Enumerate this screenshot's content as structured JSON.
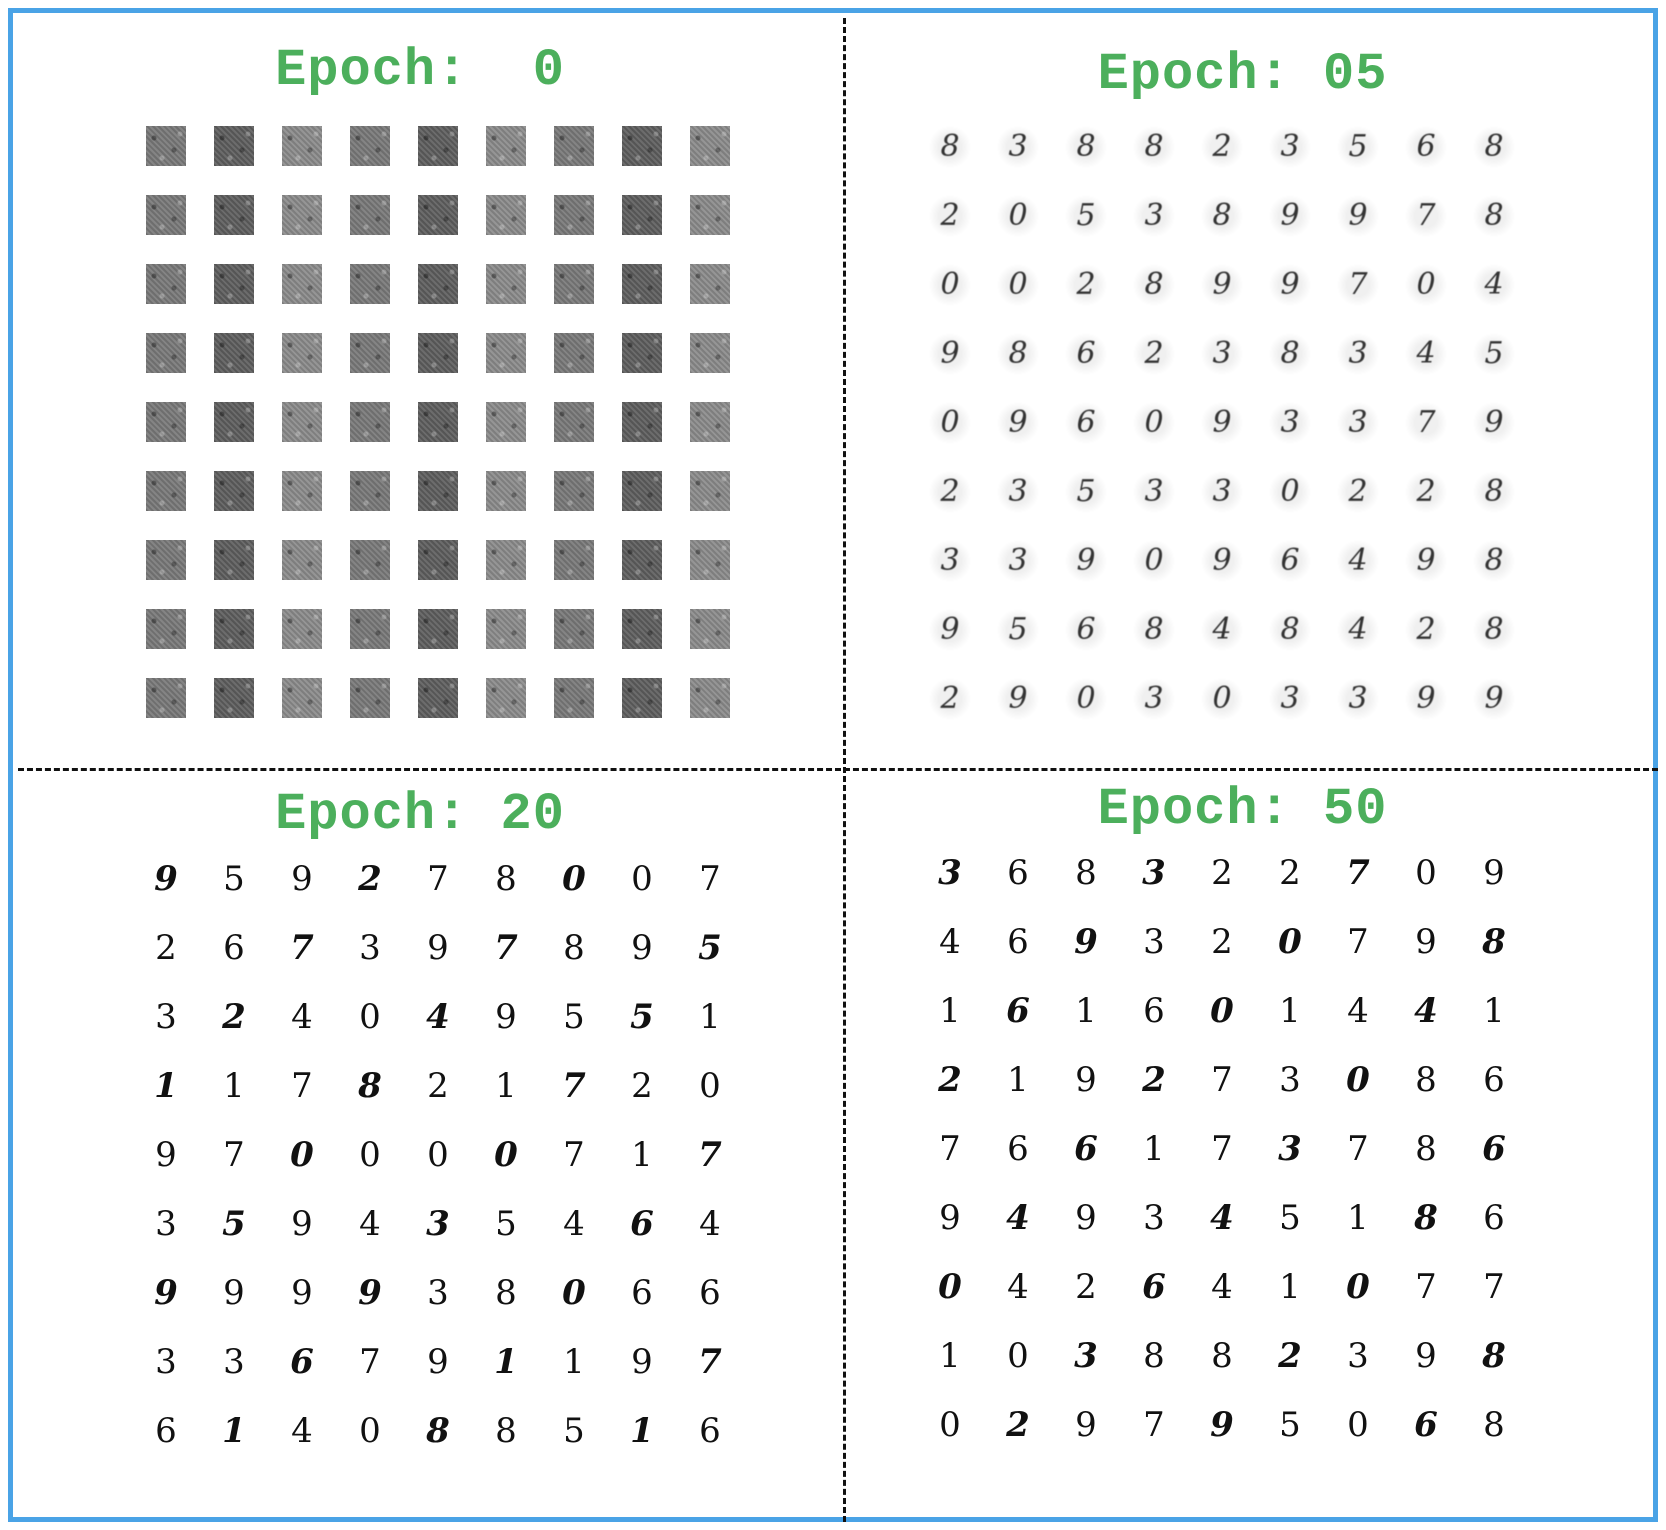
{
  "colors": {
    "frame": "#4aa3e6",
    "title": "#4caf5c",
    "divider": "#111111"
  },
  "panels": [
    {
      "title": "Epoch:  0",
      "kind": "noise",
      "rows": []
    },
    {
      "title": "Epoch: 05",
      "kind": "blurry",
      "rows": [
        [
          "8",
          "3",
          "8",
          "8",
          "2",
          "3",
          "5",
          "6",
          "8"
        ],
        [
          "2",
          "0",
          "5",
          "3",
          "8",
          "9",
          "9",
          "7",
          "8"
        ],
        [
          "0",
          "0",
          "2",
          "8",
          "9",
          "9",
          "7",
          "0",
          "4"
        ],
        [
          "9",
          "8",
          "6",
          "2",
          "3",
          "8",
          "3",
          "4",
          "5"
        ],
        [
          "0",
          "9",
          "6",
          "0",
          "9",
          "3",
          "3",
          "7",
          "9"
        ],
        [
          "2",
          "3",
          "5",
          "3",
          "3",
          "0",
          "2",
          "2",
          "8"
        ],
        [
          "3",
          "3",
          "9",
          "0",
          "9",
          "6",
          "4",
          "9",
          "8"
        ],
        [
          "9",
          "5",
          "6",
          "8",
          "4",
          "8",
          "4",
          "2",
          "8"
        ],
        [
          "2",
          "9",
          "0",
          "3",
          "0",
          "3",
          "3",
          "9",
          "9"
        ]
      ]
    },
    {
      "title": "Epoch: 20",
      "kind": "clear",
      "rows": [
        [
          "9",
          "5",
          "9",
          "2",
          "7",
          "8",
          "0",
          "0",
          "7"
        ],
        [
          "2",
          "6",
          "7",
          "3",
          "9",
          "7",
          "8",
          "9",
          "5"
        ],
        [
          "3",
          "2",
          "4",
          "0",
          "4",
          "9",
          "5",
          "5",
          "1"
        ],
        [
          "1",
          "1",
          "7",
          "8",
          "2",
          "1",
          "7",
          "2",
          "0"
        ],
        [
          "9",
          "7",
          "0",
          "0",
          "0",
          "0",
          "7",
          "1",
          "7"
        ],
        [
          "3",
          "5",
          "9",
          "4",
          "3",
          "5",
          "4",
          "6",
          "4"
        ],
        [
          "9",
          "9",
          "9",
          "9",
          "3",
          "8",
          "0",
          "6",
          "6"
        ],
        [
          "3",
          "3",
          "6",
          "7",
          "9",
          "1",
          "1",
          "9",
          "7"
        ],
        [
          "6",
          "1",
          "4",
          "0",
          "8",
          "8",
          "5",
          "1",
          "6"
        ]
      ]
    },
    {
      "title": "Epoch: 50",
      "kind": "clear",
      "rows": [
        [
          "3",
          "6",
          "8",
          "3",
          "2",
          "2",
          "7",
          "0",
          "9"
        ],
        [
          "4",
          "6",
          "9",
          "3",
          "2",
          "0",
          "7",
          "9",
          "8"
        ],
        [
          "1",
          "6",
          "1",
          "6",
          "0",
          "1",
          "4",
          "4",
          "1"
        ],
        [
          "2",
          "1",
          "9",
          "2",
          "7",
          "3",
          "0",
          "8",
          "6"
        ],
        [
          "7",
          "6",
          "6",
          "1",
          "7",
          "3",
          "7",
          "8",
          "6"
        ],
        [
          "9",
          "4",
          "9",
          "3",
          "4",
          "5",
          "1",
          "8",
          "6"
        ],
        [
          "0",
          "4",
          "2",
          "6",
          "4",
          "1",
          "0",
          "7",
          "7"
        ],
        [
          "1",
          "0",
          "3",
          "8",
          "8",
          "2",
          "3",
          "9",
          "8"
        ],
        [
          "0",
          "2",
          "9",
          "7",
          "9",
          "5",
          "0",
          "6",
          "8"
        ]
      ]
    }
  ]
}
